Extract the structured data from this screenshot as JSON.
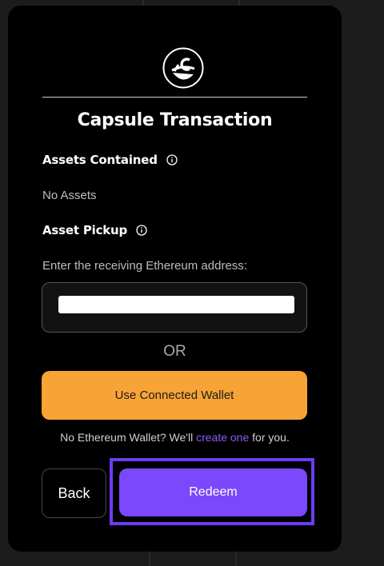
{
  "modal": {
    "title": "Capsule Transaction",
    "logo_icon": "capsule-logo-icon"
  },
  "assets": {
    "title": "Assets Contained",
    "info_icon": "info-icon",
    "status": "No Assets"
  },
  "pickup": {
    "title": "Asset Pickup",
    "info_icon": "info-icon",
    "address_label": "Enter the receiving Ethereum address:",
    "address_value": ""
  },
  "divider_text": "OR",
  "wallet_button_label": "Use Connected Wallet",
  "note": {
    "prefix": "No Ethereum Wallet? We'll ",
    "link": "create one",
    "suffix": " for you."
  },
  "actions": {
    "back_label": "Back",
    "redeem_label": "Redeem"
  },
  "colors": {
    "accent_orange": "#f7a335",
    "accent_purple": "#7b48fb",
    "link_purple": "#8b5cf6",
    "highlight": "#6d3cf5"
  }
}
